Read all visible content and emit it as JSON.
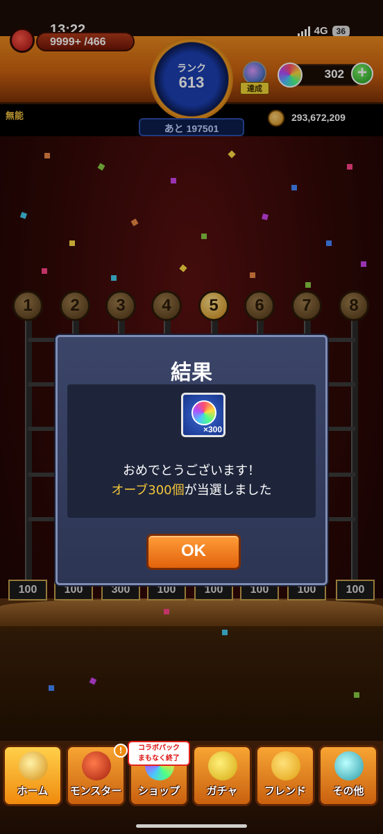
{
  "status_bar": {
    "time": "13:22",
    "network": "4G",
    "battery": "36"
  },
  "header": {
    "stamina_value": "9999+",
    "stamina_max": "/466",
    "rank_label": "ランク",
    "rank_value": "613",
    "rank_next": "あと 197501",
    "achievement_label": "達成",
    "orb_count": "302",
    "add_label": "+",
    "title_badge": "無能",
    "coin_count": "293,672,209"
  },
  "slots": [
    "1",
    "2",
    "3",
    "4",
    "5",
    "6",
    "7",
    "8"
  ],
  "prizes": [
    "100",
    "100",
    "100",
    "300",
    "100",
    "100",
    "100",
    "100"
  ],
  "dialog": {
    "title": "結果",
    "reward_qty": "×300",
    "message_line1": "おめでとうございます！",
    "message_highlight": "オーブ300個",
    "message_rest": "が当選しました",
    "ok_label": "OK"
  },
  "nav": {
    "collab_banner": [
      "コラボパック",
      "まもなく終了"
    ],
    "items": [
      {
        "label": "ホーム"
      },
      {
        "label": "モンスター"
      },
      {
        "label": "ショップ"
      },
      {
        "label": "ガチャ"
      },
      {
        "label": "フレンド"
      },
      {
        "label": "その他"
      }
    ],
    "notif": "!"
  },
  "colors": {
    "accent": "#f08a0e",
    "dialog_bg": "#2d3554",
    "highlight": "#f4c53a"
  }
}
